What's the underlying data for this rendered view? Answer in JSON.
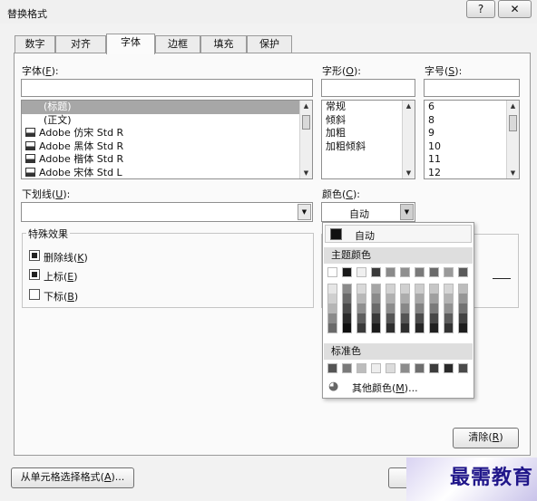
{
  "window": {
    "title": "替换格式",
    "help_label": "?",
    "close_label": "✕"
  },
  "tabs": [
    {
      "label": "数字"
    },
    {
      "label": "对齐"
    },
    {
      "label": "字体"
    },
    {
      "label": "边框"
    },
    {
      "label": "填充"
    },
    {
      "label": "保护"
    }
  ],
  "active_tab": "字体",
  "font": {
    "label": "字体(",
    "mnemonic": "F",
    "tail": "):",
    "value": "",
    "items": [
      "(标题)",
      "(正文)",
      "Adobe 仿宋 Std R",
      "Adobe 黑体 Std R",
      "Adobe 楷体 Std R",
      "Adobe 宋体 Std L"
    ],
    "selected_index": 0
  },
  "style": {
    "label": "字形(",
    "mnemonic": "O",
    "tail": "):",
    "value": "",
    "items": [
      "常规",
      "倾斜",
      "加粗",
      "加粗倾斜"
    ]
  },
  "size": {
    "label": "字号(",
    "mnemonic": "S",
    "tail": "):",
    "value": "",
    "items": [
      "6",
      "8",
      "9",
      "10",
      "11",
      "12"
    ]
  },
  "underline": {
    "label": "下划线(",
    "mnemonic": "U",
    "tail": "):",
    "value": ""
  },
  "color": {
    "label": "颜色(",
    "mnemonic": "C",
    "tail": "):",
    "value": "自动"
  },
  "effects": {
    "title": "特殊效果",
    "items": [
      {
        "label": "删除线(",
        "mnemonic": "K",
        "tail": ")",
        "checked": true
      },
      {
        "label": "上标(",
        "mnemonic": "E",
        "tail": ")",
        "checked": true
      },
      {
        "label": "下标(",
        "mnemonic": "B",
        "tail": ")",
        "checked": false
      }
    ]
  },
  "color_popup": {
    "auto_label": "自动",
    "theme_title": "主题颜色",
    "theme_top": [
      "#ffffff",
      "#1a1a1a",
      "#f0f0f0",
      "#3a3a3a",
      "#8a8a8a",
      "#8f8f8f",
      "#7a7a7a",
      "#6a6a6a",
      "#9a9a9a",
      "#5a5a5a"
    ],
    "theme_shades": [
      [
        "#e6e6e6",
        "#cfcfcf",
        "#b5b5b5",
        "#8a8a8a",
        "#6a6a6a"
      ],
      [
        "#8a8a8a",
        "#6a6a6a",
        "#4a4a4a",
        "#2a2a2a",
        "#101010"
      ],
      [
        "#d9d9d9",
        "#b8b8b8",
        "#8f8f8f",
        "#5f5f5f",
        "#3a3a3a"
      ],
      [
        "#a5a5a5",
        "#8a8a8a",
        "#6a6a6a",
        "#3a3a3a",
        "#1c1c1c"
      ],
      [
        "#d2d2d2",
        "#b0b0b0",
        "#8c8c8c",
        "#565656",
        "#2e2e2e"
      ],
      [
        "#d0d0d0",
        "#acacac",
        "#888888",
        "#555555",
        "#2f2f2f"
      ],
      [
        "#cdcdcd",
        "#a8a8a8",
        "#838383",
        "#4c4c4c",
        "#262626"
      ],
      [
        "#c6c6c6",
        "#9f9f9f",
        "#7a7a7a",
        "#474747",
        "#202020"
      ],
      [
        "#d6d6d6",
        "#b4b4b4",
        "#929292",
        "#5d5d5d",
        "#333333"
      ],
      [
        "#bdbdbd",
        "#969696",
        "#727272",
        "#434343",
        "#1e1e1e"
      ]
    ],
    "standard_title": "标准色",
    "standard": [
      "#555555",
      "#7a7a7a",
      "#bdbdbd",
      "#eeeeee",
      "#dcdcdc",
      "#8c8c8c",
      "#6e6e6e",
      "#3c3c3c",
      "#2a2a2a",
      "#4a4a4a"
    ],
    "more_label": "其他颜色(",
    "more_mnemonic": "M",
    "more_tail": ")..."
  },
  "buttons": {
    "clear_label": "清除(",
    "clear_mnemonic": "R",
    "clear_tail": ")",
    "pick_label": "从单元格选择格式(",
    "pick_mnemonic": "A",
    "pick_tail": ")..."
  },
  "watermark": {
    "text": "最需教育"
  }
}
